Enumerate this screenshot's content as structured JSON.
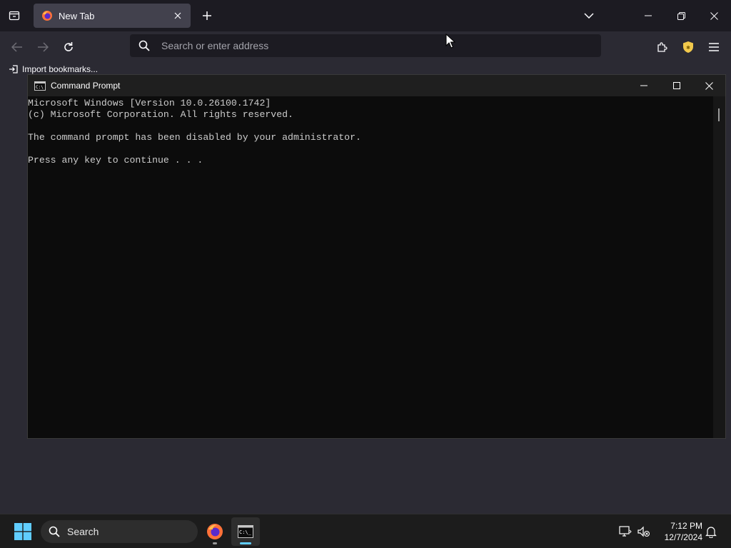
{
  "browser": {
    "tab": {
      "title": "New Tab"
    },
    "urlbar": {
      "placeholder": "Search or enter address"
    },
    "bookmarks": {
      "import_label": "Import bookmarks..."
    }
  },
  "cmd": {
    "title": "Command Prompt",
    "lines": [
      "Microsoft Windows [Version 10.0.26100.1742]",
      "(c) Microsoft Corporation. All rights reserved.",
      "",
      "The command prompt has been disabled by your administrator.",
      "",
      "Press any key to continue . . ."
    ]
  },
  "taskbar": {
    "search_label": "Search",
    "time": "7:12 PM",
    "date": "12/7/2024"
  },
  "colors": {
    "accent": "#60cdff",
    "shield": "#f2c94c"
  }
}
